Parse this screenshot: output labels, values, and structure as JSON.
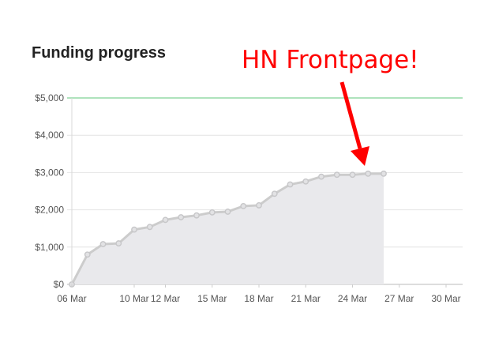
{
  "title": "Funding progress",
  "annotation": {
    "text": "HN Frontpage!",
    "color": "#ff0000",
    "points_to": "24 Mar"
  },
  "chart_data": {
    "type": "area",
    "title": "Funding progress",
    "xlabel": "",
    "ylabel": "",
    "x_range": [
      "06 Mar",
      "31 Mar"
    ],
    "ylim": [
      0,
      5000
    ],
    "grid": true,
    "goal": {
      "value": 5000,
      "color": "#5cc77a"
    },
    "y_ticks": [
      {
        "value": 0,
        "label": "$0"
      },
      {
        "value": 1000,
        "label": "$1,000"
      },
      {
        "value": 2000,
        "label": "$2,000"
      },
      {
        "value": 3000,
        "label": "$3,000"
      },
      {
        "value": 4000,
        "label": "$4,000"
      },
      {
        "value": 5000,
        "label": "$5,000"
      }
    ],
    "x_ticks": [
      {
        "day": 6,
        "label": "06 Mar"
      },
      {
        "day": 10,
        "label": "10 Mar"
      },
      {
        "day": 12,
        "label": "12 Mar"
      },
      {
        "day": 15,
        "label": "15 Mar"
      },
      {
        "day": 18,
        "label": "18 Mar"
      },
      {
        "day": 21,
        "label": "21 Mar"
      },
      {
        "day": 24,
        "label": "24 Mar"
      },
      {
        "day": 27,
        "label": "27 Mar"
      },
      {
        "day": 30,
        "label": "30 Mar"
      }
    ],
    "series": [
      {
        "line_color": "#cccccc",
        "fill_color": "#e9e9ec",
        "points": [
          {
            "day": 6,
            "value": 0
          },
          {
            "day": 7,
            "value": 800
          },
          {
            "day": 8,
            "value": 1080
          },
          {
            "day": 9,
            "value": 1100
          },
          {
            "day": 10,
            "value": 1470
          },
          {
            "day": 11,
            "value": 1540
          },
          {
            "day": 12,
            "value": 1730
          },
          {
            "day": 13,
            "value": 1800
          },
          {
            "day": 14,
            "value": 1850
          },
          {
            "day": 15,
            "value": 1930
          },
          {
            "day": 16,
            "value": 1950
          },
          {
            "day": 17,
            "value": 2100
          },
          {
            "day": 18,
            "value": 2120
          },
          {
            "day": 19,
            "value": 2430
          },
          {
            "day": 20,
            "value": 2680
          },
          {
            "day": 21,
            "value": 2760
          },
          {
            "day": 22,
            "value": 2890
          },
          {
            "day": 23,
            "value": 2940
          },
          {
            "day": 24,
            "value": 2940
          },
          {
            "day": 25,
            "value": 2970
          },
          {
            "day": 26,
            "value": 2970
          }
        ]
      }
    ]
  }
}
